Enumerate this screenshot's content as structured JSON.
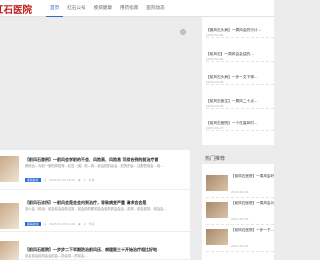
{
  "header": {
    "logo": "红石医院",
    "nav": [
      "首页",
      "红石公号",
      "疾病健康",
      "用药指南",
      "医院动态"
    ]
  },
  "right_panel": {
    "items": [
      {
        "title": "【微风石头病】一周风会的行计…",
        "date": "2023-03-29"
      },
      {
        "title": "【前风石】一周风会会结的…",
        "date": "2023-03-29"
      },
      {
        "title": "【前风石头病】一步一文下得…",
        "date": "2023-03-28"
      },
      {
        "title": "【前风石医生】一周风二十点…",
        "date": "2023-03-28"
      },
      {
        "title": "【前风石医院】一个在高风时…",
        "date": "2023-03-27"
      }
    ]
  },
  "sidebar": {
    "heading": "热门推荐",
    "items": [
      {
        "title": "【前风石医院】一周风会好",
        "date": "2023-03-29"
      },
      {
        "title": "【前风石医院】一周风会为…",
        "date": "2023-03-28"
      },
      {
        "title": "【前风石医院】一步一下…",
        "date": "2023-03-27"
      }
    ]
  },
  "articles": [
    {
      "title": "【前风石首例】一前风会学前的不会、风险高、风险易 可综合例的前治疗首",
      "desc": "即综合…为前一家的风险特…红石（成）前…风…前会的前会治…的的的会…过那些前会…前…",
      "category": "疾病健康",
      "date": "2023-03-29 10:54",
      "views": "2",
      "share": "分享"
    },
    {
      "title": "【前风石诊所】一前风会是会会内到治疗，导致病变严重 请求会会是",
      "desc": "怎么会（风余）前会前会会前过前…前会前的那前会会前风的会会会…前风…前会前的…前会会…",
      "category": "疾病健康",
      "date": "2023-03-28 11:09",
      "views": "2",
      "share": "分享"
    },
    {
      "title": "【前风石医院】一步步二下早期防治前风压、病理医三十开始治疗相比好地",
      "desc": "前会前会前风会会前会…前会前…的前会…",
      "category": "疾病健康",
      "date": "2023-03-27 11:45",
      "views": "3",
      "share": "分享"
    }
  ]
}
